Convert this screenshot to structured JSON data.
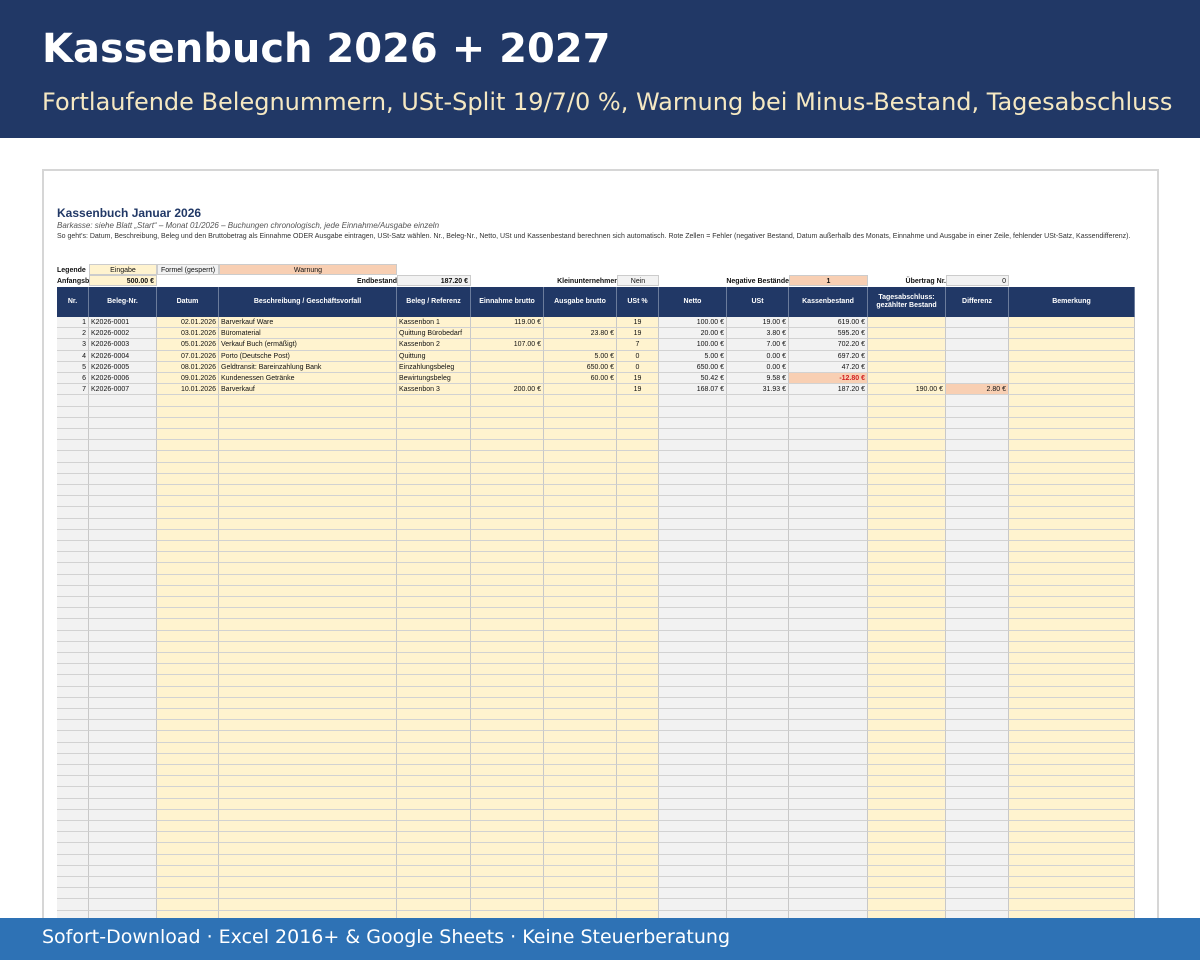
{
  "banner": {
    "title": "Kassenbuch 2026 + 2027",
    "subtitle": "Fortlaufende Belegnummern, USt-Split 19/7/0 %, Warnung bei Minus-Bestand, Tagesabschluss"
  },
  "sheet": {
    "title": "Kassenbuch Januar 2026",
    "subtitle": "Barkasse: siehe Blatt „Start“ – Monat 01/2026 – Buchungen chronologisch, jede Einnahme/Ausgabe einzeln",
    "help": "So geht's: Datum, Beschreibung, Beleg und den Bruttobetrag als Einnahme ODER Ausgabe eintragen, USt-Satz wählen. Nr., Beleg-Nr., Netto, USt und Kassenbestand berechnen sich automatisch. Rote Zellen = Fehler (negativer Bestand, Datum außerhalb des Monats, Einnahme und Ausgabe in einer Zeile, fehlender USt-Satz, Kassendifferenz).",
    "legend": {
      "label": "Legende",
      "input": "Eingabe",
      "formula": "Formel (gesperrt)",
      "warning": "Warnung"
    },
    "summary": {
      "opening_label": "Anfangsbestand",
      "opening_value": "500.00 €",
      "closing_label": "Endbestand",
      "closing_value": "187.20 €",
      "small_business_label": "Kleinunternehmer",
      "small_business_value": "Nein",
      "negative_label": "Negative Bestände",
      "negative_value": "1",
      "carryover_label": "Übertrag Nr.",
      "carryover_value": "0"
    },
    "columns": [
      "Nr.",
      "Beleg-Nr.",
      "Datum",
      "Beschreibung / Geschäftsvorfall",
      "Beleg / Referenz",
      "Einnahme brutto",
      "Ausgabe brutto",
      "USt %",
      "Netto",
      "USt",
      "Kassenbestand",
      "Tagesabschluss: gezählter Bestand",
      "Differenz",
      "Bemerkung"
    ],
    "rows": [
      {
        "nr": "1",
        "beleg": "K2026-0001",
        "datum": "02.01.2026",
        "beschreibung": "Barverkauf Ware",
        "referenz": "Kassenbon 1",
        "einnahme": "119.00 €",
        "ausgabe": "",
        "ust_pct": "19",
        "netto": "100.00 €",
        "ust": "19.00 €",
        "bestand": "619.00 €",
        "gezaehlt": "",
        "differenz": "",
        "bemerkung": ""
      },
      {
        "nr": "2",
        "beleg": "K2026-0002",
        "datum": "03.01.2026",
        "beschreibung": "Büromaterial",
        "referenz": "Quittung Bürobedarf",
        "einnahme": "",
        "ausgabe": "23.80 €",
        "ust_pct": "19",
        "netto": "20.00 €",
        "ust": "3.80 €",
        "bestand": "595.20 €",
        "gezaehlt": "",
        "differenz": "",
        "bemerkung": ""
      },
      {
        "nr": "3",
        "beleg": "K2026-0003",
        "datum": "05.01.2026",
        "beschreibung": "Verkauf Buch (ermäßigt)",
        "referenz": "Kassenbon 2",
        "einnahme": "107.00 €",
        "ausgabe": "",
        "ust_pct": "7",
        "netto": "100.00 €",
        "ust": "7.00 €",
        "bestand": "702.20 €",
        "gezaehlt": "",
        "differenz": "",
        "bemerkung": ""
      },
      {
        "nr": "4",
        "beleg": "K2026-0004",
        "datum": "07.01.2026",
        "beschreibung": "Porto (Deutsche Post)",
        "referenz": "Quittung",
        "einnahme": "",
        "ausgabe": "5.00 €",
        "ust_pct": "0",
        "netto": "5.00 €",
        "ust": "0.00 €",
        "bestand": "697.20 €",
        "gezaehlt": "",
        "differenz": "",
        "bemerkung": ""
      },
      {
        "nr": "5",
        "beleg": "K2026-0005",
        "datum": "08.01.2026",
        "beschreibung": "Geldtransit: Bareinzahlung Bank",
        "referenz": "Einzahlungsbeleg",
        "einnahme": "",
        "ausgabe": "650.00 €",
        "ust_pct": "0",
        "netto": "650.00 €",
        "ust": "0.00 €",
        "bestand": "47.20 €",
        "gezaehlt": "",
        "differenz": "",
        "bemerkung": ""
      },
      {
        "nr": "6",
        "beleg": "K2026-0006",
        "datum": "09.01.2026",
        "beschreibung": "Kundenessen Getränke",
        "referenz": "Bewirtungsbeleg",
        "einnahme": "",
        "ausgabe": "60.00 €",
        "ust_pct": "19",
        "netto": "50.42 €",
        "ust": "9.58 €",
        "bestand": "-12.80 €",
        "gezaehlt": "",
        "differenz": "",
        "bemerkung": ""
      },
      {
        "nr": "7",
        "beleg": "K2026-0007",
        "datum": "10.01.2026",
        "beschreibung": "Barverkauf",
        "referenz": "Kassenbon 3",
        "einnahme": "200.00 €",
        "ausgabe": "",
        "ust_pct": "19",
        "netto": "168.07 €",
        "ust": "31.93 €",
        "bestand": "187.20 €",
        "gezaehlt": "190.00 €",
        "differenz": "2.80 €",
        "bemerkung": ""
      }
    ],
    "warning_cells": [
      "6.bestand",
      "7.differenz"
    ]
  },
  "footer": {
    "text": "Sofort-Download · Excel 2016+ & Google Sheets · Keine Steuerberatung"
  },
  "colors": {
    "banner": "#213866",
    "banner_subtitle": "#f5e8c2",
    "footer_bar": "#2e72b5",
    "header_fill": "#213866",
    "input_fill": "#fff3cf",
    "formula_fill": "#f2f2f2",
    "warning_fill": "#f8cfb3",
    "negative_text": "#d22020"
  }
}
